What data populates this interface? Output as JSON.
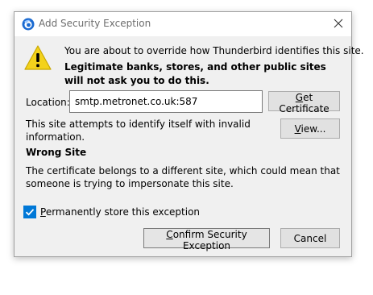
{
  "window": {
    "title": "Add Security Exception"
  },
  "message": {
    "intro": "You are about to override how Thunderbird identifies this site.",
    "warning": "Legitimate banks, stores, and other public sites will not ask you to do this."
  },
  "location": {
    "label": "Location:",
    "value": "smtp.metronet.co.uk:587"
  },
  "buttons": {
    "get_certificate": "Get Certificate",
    "view": "View...",
    "confirm": "Confirm Security Exception",
    "cancel": "Cancel"
  },
  "status": {
    "attempt_text": "This site attempts to identify itself with invalid information.",
    "heading": "Wrong Site",
    "description": "The certificate belongs to a different site, which could mean that someone is trying to impersonate this site."
  },
  "permanent": {
    "label": "Permanently store this exception",
    "checked": true
  },
  "colors": {
    "accent": "#0078d7",
    "warning_yellow": "#f3d21c"
  },
  "icons": {
    "app": "thunderbird-icon",
    "warning": "warning-icon",
    "close": "close-icon",
    "check": "checkmark-icon"
  }
}
